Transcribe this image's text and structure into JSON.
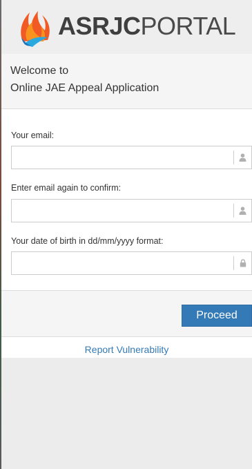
{
  "header": {
    "brand_bold": "ASRJC",
    "brand_light": "PORTAL",
    "logo_icon": "asrjc-flame-logo-icon"
  },
  "welcome": {
    "line1": "Welcome to",
    "line2": "Online JAE Appeal Application"
  },
  "form": {
    "email": {
      "label": "Your email:",
      "value": "",
      "placeholder": "",
      "icon": "user-icon"
    },
    "email_confirm": {
      "label": "Enter email again to confirm:",
      "value": "",
      "placeholder": "",
      "icon": "user-icon"
    },
    "dob": {
      "label": "Your date of birth in dd/mm/yyyy format:",
      "value": "",
      "placeholder": "",
      "icon": "lock-icon"
    }
  },
  "actions": {
    "proceed_label": "Proceed"
  },
  "links": {
    "report_vulnerability": "Report Vulnerability"
  },
  "colors": {
    "primary": "#337ab7",
    "logo_orange": "#f15a24",
    "logo_blue": "#29a9e0",
    "icon_grey": "#b0b0b0"
  }
}
